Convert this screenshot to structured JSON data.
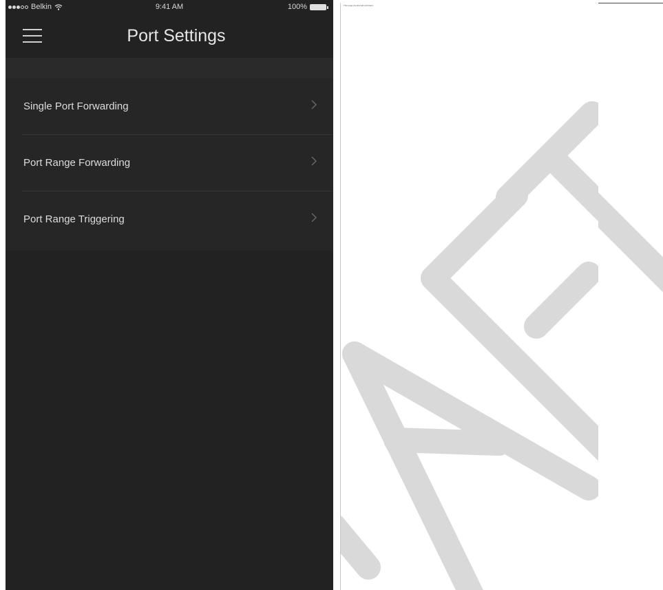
{
  "status_bar": {
    "carrier": "Belkin",
    "time": "9:41 AM",
    "battery": "100%",
    "signal_icon": "signal-dots-icon",
    "wifi_icon": "wifi-icon",
    "battery_icon": "battery-icon"
  },
  "header": {
    "title": "Port Settings",
    "menu_icon": "hamburger-menu-icon"
  },
  "menu": {
    "items": [
      {
        "label": "Single Port Forwarding",
        "icon": "chevron-right-icon"
      },
      {
        "label": "Port Range Forwarding",
        "icon": "chevron-right-icon"
      },
      {
        "label": "Port Range Triggering",
        "icon": "chevron-right-icon"
      }
    ]
  },
  "document": {
    "note": "This page intentionally left blank.",
    "watermark": "DRAFT"
  },
  "colors": {
    "screen_bg": "#222222",
    "list_bg": "#262626",
    "text": "#dcdcdc",
    "watermark": "#d9d9d9"
  }
}
